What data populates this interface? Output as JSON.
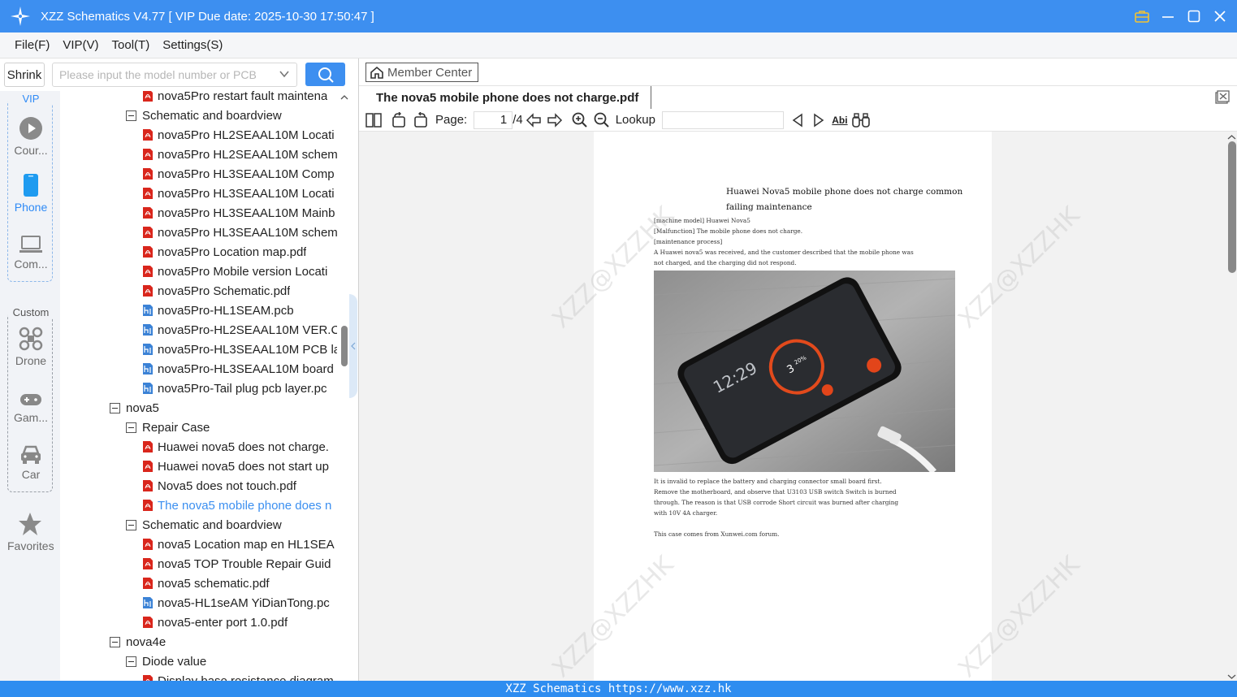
{
  "titlebar": {
    "title": "XZZ Schematics V4.77 [ VIP Due date: 2025-10-30 17:50:47 ]"
  },
  "menu": [
    "File(F)",
    "VIP(V)",
    "Tool(T)",
    "Settings(S)"
  ],
  "search": {
    "shrink_label": "Shrink",
    "placeholder": "Please input the model number or PCB"
  },
  "nav": {
    "vip_label": "VIP",
    "vip_items": [
      "Cour...",
      "Phone",
      "Com..."
    ],
    "custom_label": "Custom",
    "custom_items": [
      "Drone",
      "Gam...",
      "Car"
    ],
    "favorites": "Favorites",
    "active_color": "#2e8af6"
  },
  "tree": [
    {
      "level": 2,
      "type": "pdf",
      "label": "nova5Pro restart fault maintena"
    },
    {
      "level": 1,
      "type": "folder",
      "label": "Schematic and boardview"
    },
    {
      "level": 2,
      "type": "pdf",
      "label": "nova5Pro HL2SEAAL10M Locati"
    },
    {
      "level": 2,
      "type": "pdf",
      "label": "nova5Pro HL2SEAAL10M schem"
    },
    {
      "level": 2,
      "type": "pdf",
      "label": "nova5Pro HL3SEAAL10M Comp"
    },
    {
      "level": 2,
      "type": "pdf",
      "label": "nova5Pro HL3SEAAL10M Locati"
    },
    {
      "level": 2,
      "type": "pdf",
      "label": "nova5Pro HL3SEAAL10M Mainb"
    },
    {
      "level": 2,
      "type": "pdf",
      "label": "nova5Pro HL3SEAAL10M schem"
    },
    {
      "level": 2,
      "type": "pdf",
      "label": "nova5Pro Location map.pdf"
    },
    {
      "level": 2,
      "type": "pdf",
      "label": "nova5Pro Mobile version Locati"
    },
    {
      "level": 2,
      "type": "pdf",
      "label": "nova5Pro Schematic.pdf"
    },
    {
      "level": 2,
      "type": "pcb",
      "label": "nova5Pro-HL1SEAM.pcb"
    },
    {
      "level": 2,
      "type": "pcb",
      "label": "nova5Pro-HL2SEAAL10M VER.C"
    },
    {
      "level": 2,
      "type": "pcb",
      "label": "nova5Pro-HL3SEAAL10M PCB la"
    },
    {
      "level": 2,
      "type": "pcb",
      "label": "nova5Pro-HL3SEAAL10M board"
    },
    {
      "level": 2,
      "type": "pcb",
      "label": "nova5Pro-Tail plug pcb layer.pc"
    },
    {
      "level": 0,
      "type": "folder",
      "label": "nova5"
    },
    {
      "level": 1,
      "type": "folder",
      "label": "Repair Case"
    },
    {
      "level": 2,
      "type": "pdf",
      "label": "Huawei nova5 does not charge."
    },
    {
      "level": 2,
      "type": "pdf",
      "label": "Huawei nova5 does not start up"
    },
    {
      "level": 2,
      "type": "pdf",
      "label": "Nova5 does not touch.pdf"
    },
    {
      "level": 2,
      "type": "pdf",
      "label": "The nova5 mobile phone does n",
      "selected": true
    },
    {
      "level": 1,
      "type": "folder",
      "label": "Schematic and boardview"
    },
    {
      "level": 2,
      "type": "pdf",
      "label": "nova5 Location map en HL1SEA"
    },
    {
      "level": 2,
      "type": "pdf",
      "label": "nova5 TOP Trouble Repair Guid"
    },
    {
      "level": 2,
      "type": "pdf",
      "label": "nova5 schematic.pdf"
    },
    {
      "level": 2,
      "type": "pcb",
      "label": "nova5-HL1seAM YiDianTong.pc"
    },
    {
      "level": 2,
      "type": "pdf",
      "label": "nova5-enter port 1.0.pdf"
    },
    {
      "level": 0,
      "type": "folder",
      "label": "nova4e"
    },
    {
      "level": 1,
      "type": "folder",
      "label": "Diode value"
    },
    {
      "level": 2,
      "type": "pdf",
      "label": "Display base resistance diagram"
    }
  ],
  "viewer": {
    "member_center": "Member Center",
    "tab_title": "The nova5 mobile phone does not charge.pdf",
    "page_label": "Page:",
    "page_current": "1",
    "page_total": "/4",
    "lookup_label": "Lookup",
    "abi_label": "Abi"
  },
  "document": {
    "title_line1": "Huawei Nova5 mobile phone does not charge common",
    "title_line2": "failing maintenance",
    "lines_top": [
      "[machine model] Huawei Nova5",
      "[Malfunction] The mobile phone does not charge.",
      "[maintenance process]",
      "    A Huawei nova5 was received, and the customer described that the mobile phone was",
      "not charged, and the charging did not respond."
    ],
    "lines_bottom": [
      "    It is invalid to replace the battery and charging connector small board first.",
      "    Remove the motherboard, and observe that U3103 USB switch Switch is burned",
      "through. The reason is that USB corrode Short circuit was burned after charging",
      "with 10V 4A charger.",
      "",
      "This case comes from Xunwei.com forum."
    ],
    "photo_time": "12:29",
    "photo_charge": "3",
    "photo_percent": "20%",
    "watermark": "XZZ@XZZHK"
  },
  "statusbar": {
    "text": "XZZ Schematics https://www.xzz.hk"
  },
  "colors": {
    "titlebar": "#3d8ff0",
    "accent": "#2e8df0",
    "pdf_icon": "#d9261c",
    "pcb_icon": "#3b82d6"
  }
}
